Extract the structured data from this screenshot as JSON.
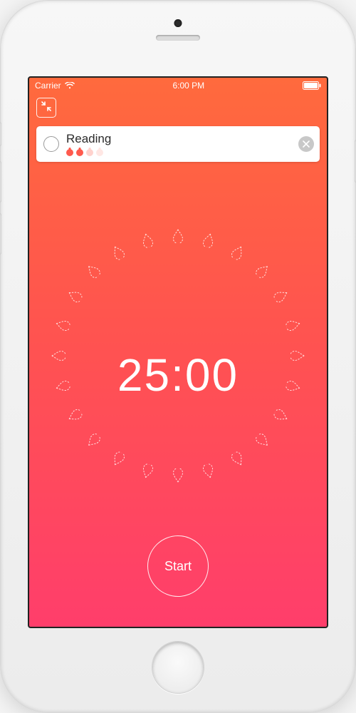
{
  "statusbar": {
    "carrier": "Carrier",
    "time": "6:00 PM"
  },
  "task": {
    "title": "Reading",
    "pomodoros_done": 2,
    "pomodoros_total": 4
  },
  "timer": {
    "display": "25:00",
    "ticks": 24
  },
  "buttons": {
    "start": "Start"
  },
  "colors": {
    "gradient_top": "#ff6a3d",
    "gradient_bottom": "#ff3e6b",
    "pomo": "#ff5a4d"
  }
}
